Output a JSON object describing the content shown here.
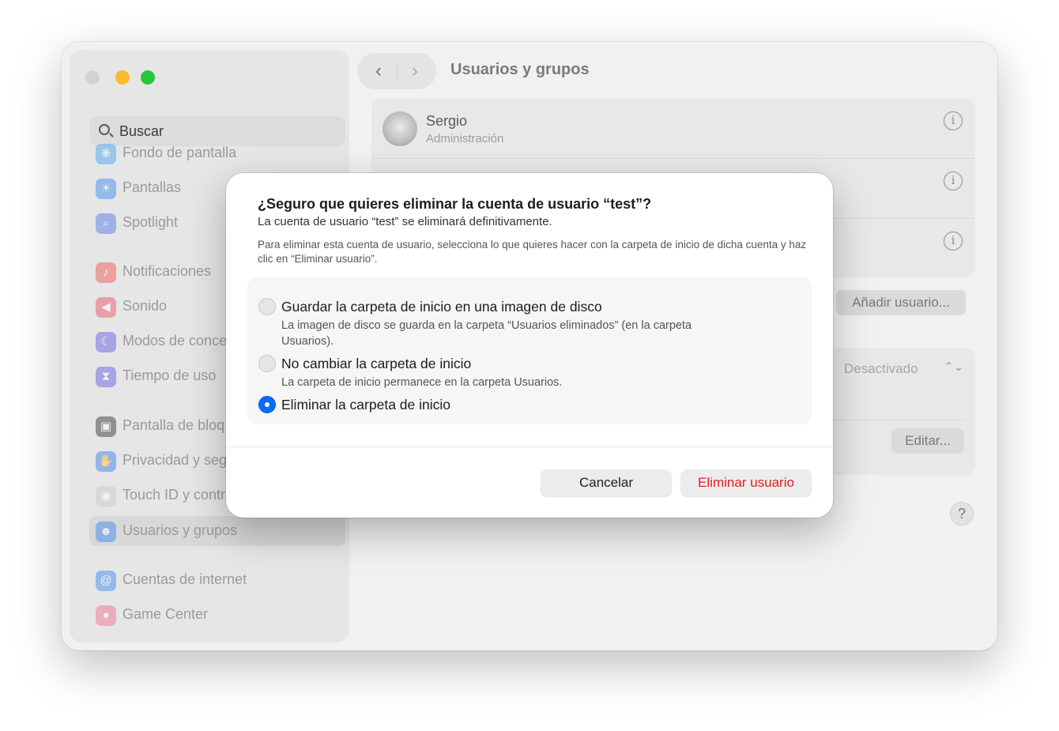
{
  "window": {
    "title": "Usuarios y grupos"
  },
  "traffic_lights": {
    "close": "#d3d3d3",
    "minimize": "#f8bd2c",
    "zoom": "#27c840"
  },
  "sidebar": {
    "search_placeholder": "Buscar",
    "items": [
      {
        "label": "Fondo de pantalla",
        "icon": "wallpaper-icon",
        "color": "#3ea0f0",
        "glyph": "❋"
      },
      {
        "label": "Pantallas",
        "icon": "display-icon",
        "color": "#2f86f0",
        "glyph": "☀"
      },
      {
        "label": "Spotlight",
        "icon": "spotlight-icon",
        "color": "#4d6ef0",
        "glyph": "⌕"
      },
      {
        "label": "Notificaciones",
        "icon": "notifications-icon",
        "color": "#f24a4a",
        "glyph": "🔔"
      },
      {
        "label": "Sonido",
        "icon": "sound-icon",
        "color": "#f04a5a",
        "glyph": "🔊"
      },
      {
        "label": "Modos de conce",
        "icon": "focus-icon",
        "color": "#5a55e0",
        "glyph": "☾"
      },
      {
        "label": "Tiempo de uso",
        "icon": "screen-time-icon",
        "color": "#5a55e0",
        "glyph": "⧗"
      },
      {
        "label": "Pantalla de bloq",
        "icon": "lock-screen-icon",
        "color": "#2a2a2a",
        "glyph": "🔒"
      },
      {
        "label": "Privacidad y seg",
        "icon": "privacy-icon",
        "color": "#2f7cf0",
        "glyph": "✋"
      },
      {
        "label": "Touch ID y contr",
        "icon": "touch-id-icon",
        "color": "#d0d0d0",
        "glyph": "◉"
      },
      {
        "label": "Usuarios y grupos",
        "icon": "users-groups-icon",
        "color": "#2f86f0",
        "glyph": "👥"
      },
      {
        "label": "Cuentas de internet",
        "icon": "internet-accounts-icon",
        "color": "#2f86f0",
        "glyph": "@"
      },
      {
        "label": "Game Center",
        "icon": "game-center-icon",
        "color": "#f06a8a",
        "glyph": "●"
      }
    ]
  },
  "main": {
    "users": [
      {
        "name": "Sergio",
        "role": "Administración"
      }
    ],
    "add_user_label": "Añadir usuario...",
    "auto_login_value": "Desactivado",
    "edit_label": "Editar...",
    "help_label": "?"
  },
  "dialog": {
    "title": "¿Seguro que quieres eliminar la cuenta de usuario “test”?",
    "subtitle": "La cuenta de usuario “test” se eliminará definitivamente.",
    "description": "Para eliminar esta cuenta de usuario, selecciona lo que quieres hacer con la carpeta de inicio de dicha cuenta y haz clic en “Eliminar usuario”.",
    "options": [
      {
        "label": "Guardar la carpeta de inicio en una imagen de disco",
        "description": "La imagen de disco se guarda en la carpeta “Usuarios eliminados” (en la carpeta Usuarios).",
        "selected": false
      },
      {
        "label": "No cambiar la carpeta de inicio",
        "description": "La carpeta de inicio permanece en la carpeta Usuarios.",
        "selected": false
      },
      {
        "label": "Eliminar la carpeta de inicio",
        "description": "",
        "selected": true
      }
    ],
    "cancel_label": "Cancelar",
    "delete_label": "Eliminar usuario",
    "accent_color": "#0a6cf5",
    "destructive_color": "#e02020"
  }
}
